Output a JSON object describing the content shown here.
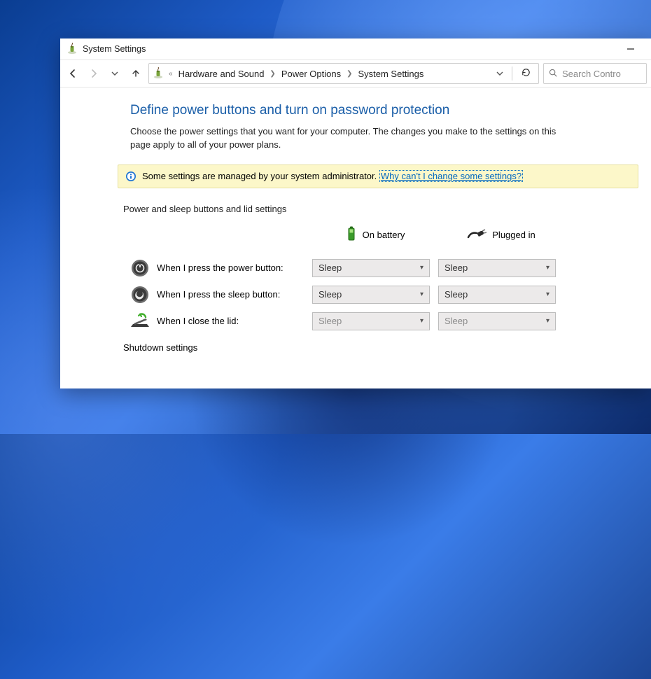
{
  "window": {
    "title": "System Settings"
  },
  "breadcrumbs": {
    "overflow_prefix": "«",
    "items": [
      "Hardware and Sound",
      "Power Options",
      "System Settings"
    ]
  },
  "search": {
    "placeholder": "Search Contro"
  },
  "page": {
    "title": "Define power buttons and turn on password protection",
    "description": "Choose the power settings that you want for your computer. The changes you make to the settings on this page apply to all of your power plans."
  },
  "admin_banner": {
    "text": "Some settings are managed by your system administrator.",
    "link": "Why can't I change some settings?"
  },
  "sections": {
    "buttons_lid_label": "Power and sleep buttons and lid settings",
    "shutdown_label": "Shutdown settings"
  },
  "columns": {
    "battery": "On battery",
    "plugged": "Plugged in"
  },
  "rows": [
    {
      "id": "power-button",
      "label": "When I press the power button:",
      "battery": "Sleep",
      "plugged": "Sleep",
      "disabled": false
    },
    {
      "id": "sleep-button",
      "label": "When I press the sleep button:",
      "battery": "Sleep",
      "plugged": "Sleep",
      "disabled": false
    },
    {
      "id": "close-lid",
      "label": "When I close the lid:",
      "battery": "Sleep",
      "plugged": "Sleep",
      "disabled": true
    }
  ]
}
